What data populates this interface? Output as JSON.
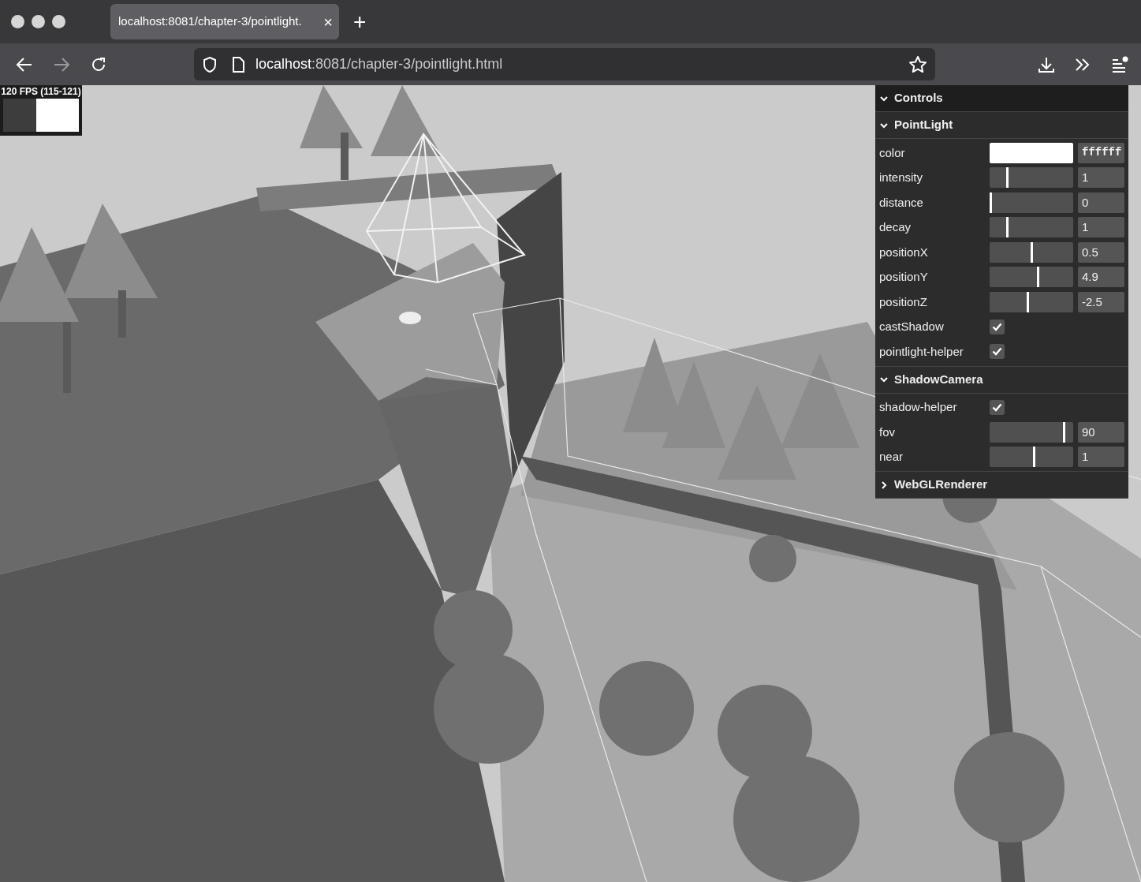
{
  "browser": {
    "tab": {
      "title": "localhost:8081/chapter-3/pointlight.",
      "close": "×",
      "selected": true
    },
    "new_tab": "+",
    "address": {
      "host": "localhost",
      "path": ":8081/chapter-3/pointlight.html"
    },
    "forward_disabled": true
  },
  "stats": {
    "fps": "120 FPS (115-121)"
  },
  "gui": {
    "title": "Controls",
    "expanded": true,
    "folders": [
      {
        "title": "PointLight",
        "expanded": true,
        "rows": [
          {
            "kind": "color",
            "label": "color",
            "value": "ffffff",
            "color": "#ffffff"
          },
          {
            "kind": "slider",
            "label": "intensity",
            "value": "1",
            "level": 0.2
          },
          {
            "kind": "slider",
            "label": "distance",
            "value": "0",
            "level": 0
          },
          {
            "kind": "slider",
            "label": "decay",
            "value": "1",
            "level": 0.2
          },
          {
            "kind": "slider",
            "label": "positionX",
            "value": "0.5",
            "level": 0.5
          },
          {
            "kind": "slider",
            "label": "positionY",
            "value": "4.9",
            "level": 0.58
          },
          {
            "kind": "slider",
            "label": "positionZ",
            "value": "-2.5",
            "level": 0.46
          },
          {
            "kind": "checkbox",
            "label": "castShadow",
            "checked": true
          },
          {
            "kind": "checkbox",
            "label": "pointlight-helper",
            "checked": true
          }
        ]
      },
      {
        "title": "ShadowCamera",
        "expanded": true,
        "rows": [
          {
            "kind": "checkbox",
            "label": "shadow-helper",
            "checked": true
          },
          {
            "kind": "slider",
            "label": "fov",
            "value": "90",
            "level": 0.9
          },
          {
            "kind": "slider",
            "label": "near",
            "value": "1",
            "level": 0.53
          }
        ]
      },
      {
        "title": "WebGLRenderer",
        "expanded": false
      }
    ]
  }
}
